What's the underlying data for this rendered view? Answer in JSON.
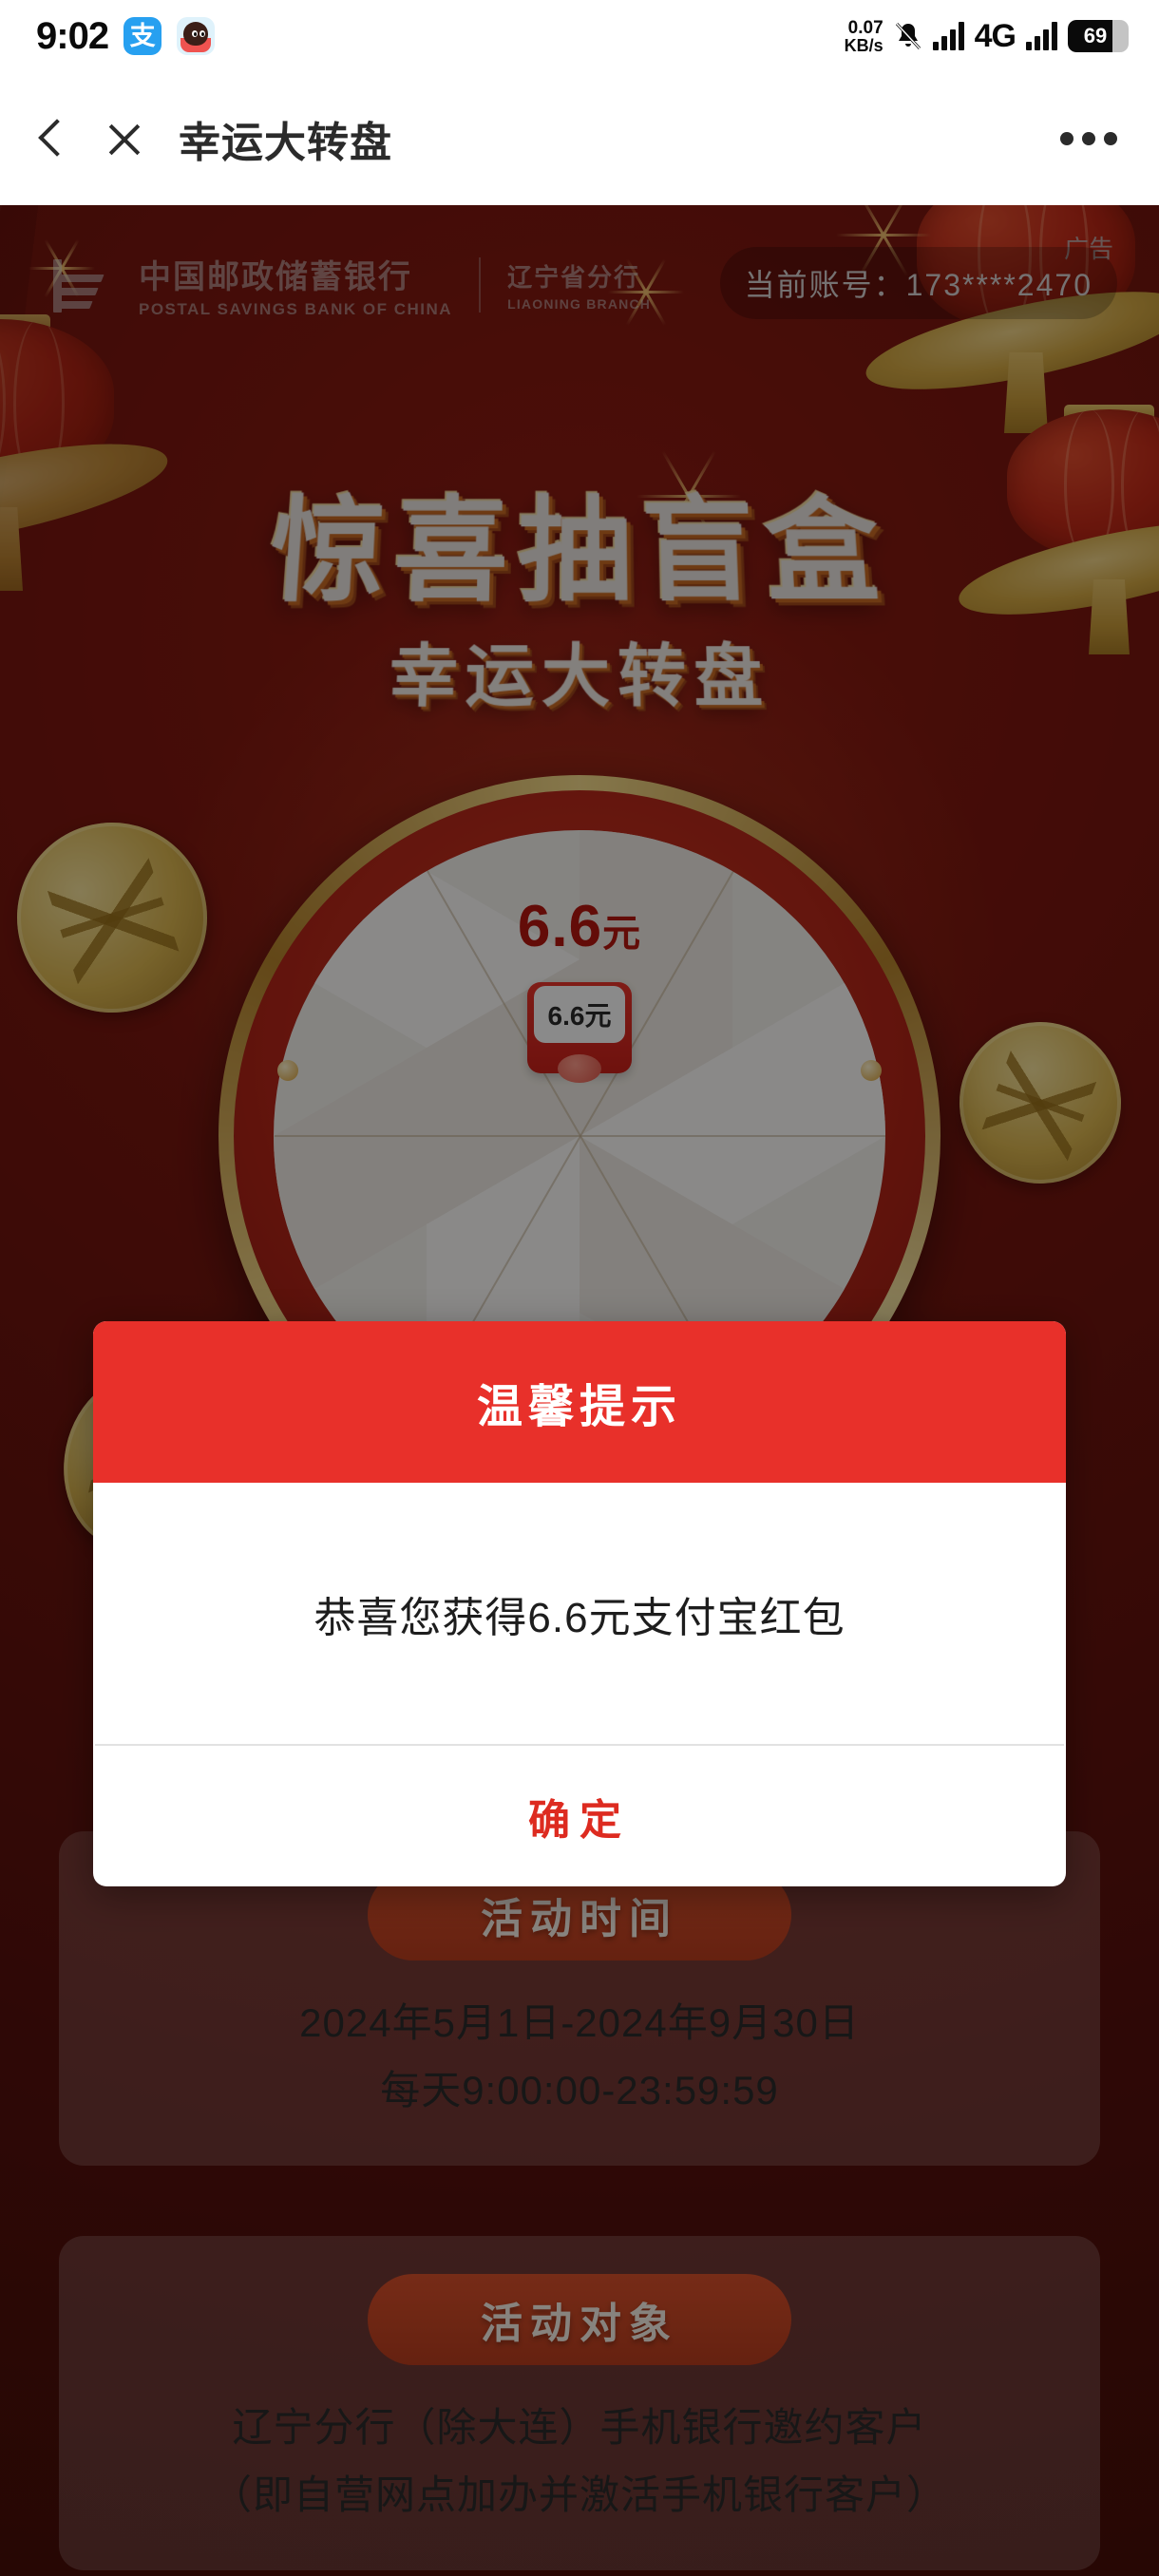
{
  "statusbar": {
    "time": "9:02",
    "apps": [
      {
        "name": "alipay-app-icon",
        "glyph": "支"
      },
      {
        "name": "character-app-icon",
        "glyph": ""
      }
    ],
    "network_speed_value": "0.07",
    "network_speed_unit": "KB/s",
    "mute_icon": "bell-slash-icon",
    "signal_icon": "signal-bars-icon",
    "network_type": "4G",
    "signal_icon_2": "signal-bars-icon",
    "battery_percent": "69"
  },
  "navbar": {
    "back_icon": "chevron-left-icon",
    "close_icon": "close-icon",
    "title": "幸运大转盘",
    "more_icon": "more-dots-icon"
  },
  "banner": {
    "bank_name_cn": "中国邮政储蓄银行",
    "bank_name_en": "POSTAL SAVINGS BANK OF CHINA",
    "branch_cn": "辽宁省分行",
    "branch_en": "LIAONING BRANCH",
    "account_label": "当前账号：173****2470",
    "ad_label": "广告",
    "headline_main": "惊喜抽盲盒",
    "headline_sub": "幸运大转盘"
  },
  "wheel": {
    "prize_top": "6.6",
    "prize_top_unit": "元",
    "hongbao_label": "6.6元"
  },
  "cards": [
    {
      "pill": "活动时间",
      "lines": [
        "2024年5月1日-2024年9月30日",
        "每天9:00:00-23:59:59"
      ]
    },
    {
      "pill": "活动对象",
      "lines": [
        "辽宁分行（除大连）手机银行邀约客户",
        "（即自营网点加办并激活手机银行客户）"
      ]
    }
  ],
  "dialog": {
    "title": "温馨提示",
    "message": "恭喜您获得6.6元支付宝红包",
    "confirm_label": "确定"
  },
  "colors": {
    "dialog_header": "#E8302A",
    "confirm_text": "#DD2B20",
    "page_red": "#6E140D",
    "gold": "#D9B44F"
  }
}
